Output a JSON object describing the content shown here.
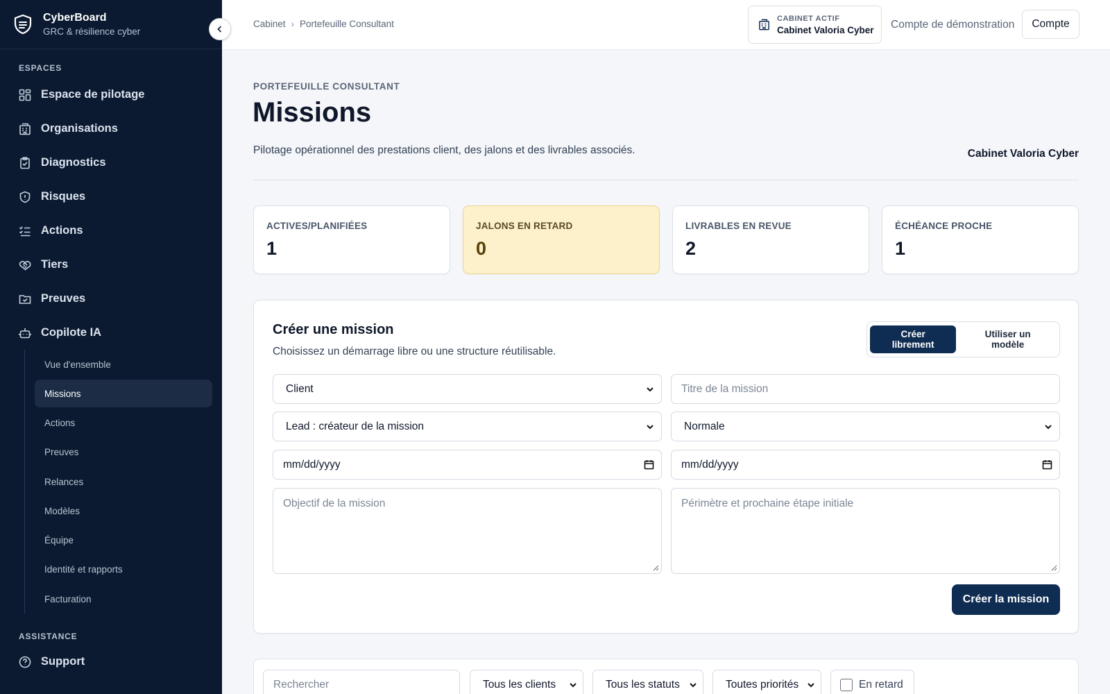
{
  "brand": {
    "name": "CyberBoard",
    "subtitle": "GRC & résilience cyber"
  },
  "sidebar": {
    "sections": {
      "espaces": "ESPACES",
      "assistance": "ASSISTANCE"
    },
    "items": [
      {
        "label": "Espace de pilotage",
        "icon": "dashboard-icon"
      },
      {
        "label": "Organisations",
        "icon": "building-icon"
      },
      {
        "label": "Diagnostics",
        "icon": "clipboard-icon"
      },
      {
        "label": "Risques",
        "icon": "shield-icon"
      },
      {
        "label": "Actions",
        "icon": "checklist-icon"
      },
      {
        "label": "Tiers",
        "icon": "handshake-icon"
      },
      {
        "label": "Preuves",
        "icon": "folder-check-icon"
      },
      {
        "label": "Copilote IA",
        "icon": "robot-icon"
      }
    ],
    "subitems": [
      {
        "label": "Vue d'ensemble"
      },
      {
        "label": "Missions",
        "active": true
      },
      {
        "label": "Actions"
      },
      {
        "label": "Preuves"
      },
      {
        "label": "Relances"
      },
      {
        "label": "Modèles"
      },
      {
        "label": "Équipe"
      },
      {
        "label": "Identité et rapports"
      },
      {
        "label": "Facturation"
      }
    ],
    "support": {
      "label": "Support",
      "icon": "help-circle-icon"
    }
  },
  "topbar": {
    "breadcrumb": [
      "Cabinet",
      "Portefeuille Consultant"
    ],
    "cabinet_label": "CABINET ACTIF",
    "cabinet_value": "Cabinet Valoria Cyber",
    "demo_text": "Compte de démonstration",
    "account_button": "Compte"
  },
  "header": {
    "eyebrow": "PORTEFEUILLE CONSULTANT",
    "title": "Missions",
    "description": "Pilotage opérationnel des prestations client, des jalons et des livrables associés.",
    "cabinet": "Cabinet Valoria Cyber"
  },
  "stats": [
    {
      "label": "ACTIVES/PLANIFIÉES",
      "value": "1"
    },
    {
      "label": "JALONS EN RETARD",
      "value": "0"
    },
    {
      "label": "LIVRABLES EN REVUE",
      "value": "2"
    },
    {
      "label": "ÉCHÉANCE PROCHE",
      "value": "1"
    }
  ],
  "create": {
    "title": "Créer une mission",
    "subtitle": "Choisissez un démarrage libre ou une structure réutilisable.",
    "mode_free": "Créer librement",
    "mode_template": "Utiliser un modèle",
    "client_select": "Client",
    "title_placeholder": "Titre de la mission",
    "lead_select": "Lead : créateur de la mission",
    "priority_select": "Normale",
    "start_date": "mm/dd/yyyy",
    "end_date": "mm/dd/yyyy",
    "objective_placeholder": "Objectif de la mission",
    "scope_placeholder": "Périmètre et prochaine étape initiale",
    "submit": "Créer la mission"
  },
  "filters": {
    "search_placeholder": "Rechercher",
    "clients": "Tous les clients",
    "statuses": "Tous les statuts",
    "priorities": "Toutes priorités",
    "late": "En retard"
  },
  "colors": {
    "sidebar_bg": "#0b1a30",
    "primary": "#0f2c52",
    "warning_bg": "#fdf1cb"
  }
}
